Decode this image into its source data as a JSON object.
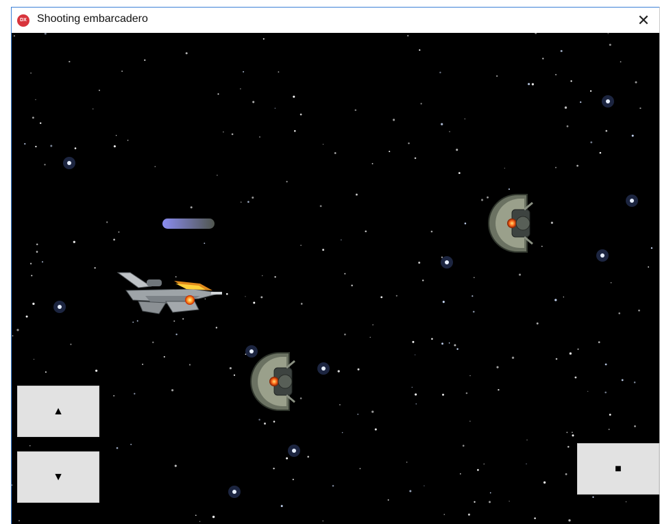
{
  "window": {
    "title": "Shooting embarcadero",
    "icon": "delphi-fmx-app-icon",
    "icon_text": "DX",
    "close_glyph": "✕"
  },
  "controls": {
    "up_glyph": "▲",
    "down_glyph": "▼",
    "stop_glyph": "■"
  },
  "colors": {
    "background": "#000000",
    "button": "#e2e2e2",
    "laser_start": "#8a8cf0",
    "laser_end": "#555a55",
    "enemy_core": "#ff6a1a"
  }
}
